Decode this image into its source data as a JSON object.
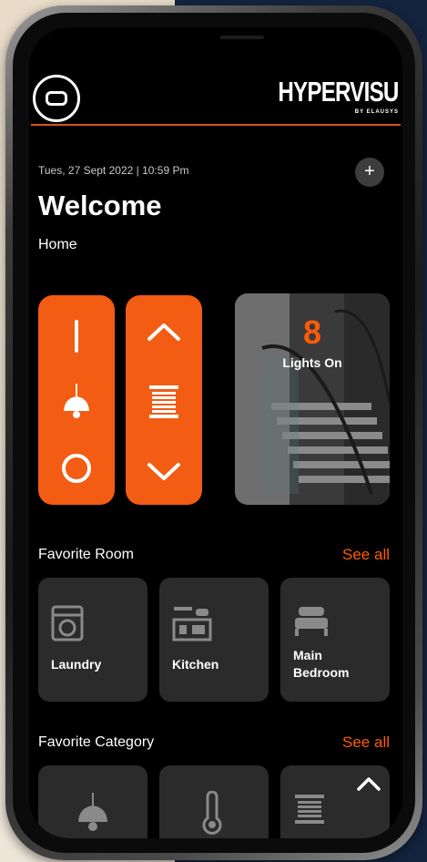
{
  "app": {
    "brand_name": "HYPERVISU",
    "brand_sub": "BY ELAUSYS"
  },
  "header": {
    "datetime": "Tues, 27 Sept 2022 | 10:59 Pm",
    "add_label": "+",
    "welcome": "Welcome",
    "location": "Home"
  },
  "quick_controls": {
    "light": [
      "on-line-icon",
      "ceiling-lamp-icon",
      "off-circle-icon"
    ],
    "blind": [
      "chevron-up-icon",
      "blinds-icon",
      "chevron-down-icon"
    ]
  },
  "lights_card": {
    "count": "8",
    "label": "Lights On"
  },
  "favorite_room": {
    "title": "Favorite Room",
    "see_all": "See all",
    "rooms": [
      {
        "label": "Laundry",
        "icon": "washing-machine-icon"
      },
      {
        "label": "Kitchen",
        "icon": "kitchen-icon"
      },
      {
        "label": "Main\nBedroom",
        "icon": "bed-icon"
      }
    ]
  },
  "favorite_category": {
    "title": "Favorite Category",
    "see_all": "See all",
    "categories": [
      {
        "icon": "ceiling-lamp-icon"
      },
      {
        "icon": "thermometer-icon"
      },
      {
        "icon": "blinds-icon"
      }
    ]
  },
  "colors": {
    "accent": "#f25c13",
    "background": "#000000",
    "tile": "#2b2b2b"
  }
}
